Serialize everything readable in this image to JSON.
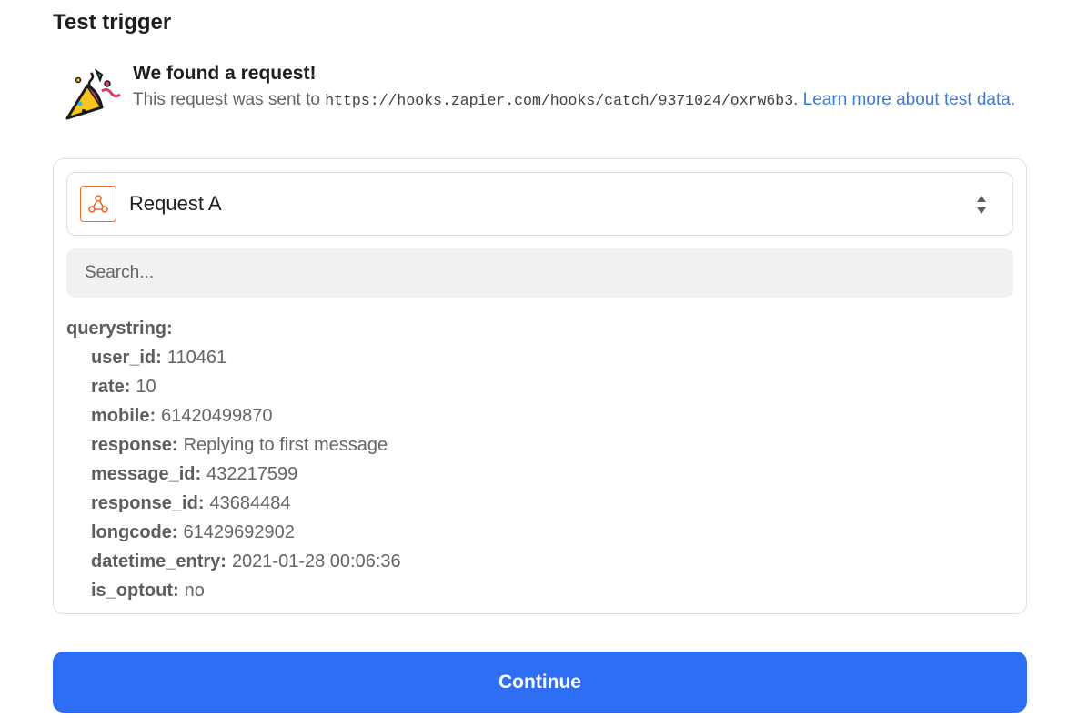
{
  "page": {
    "title": "Test trigger"
  },
  "found": {
    "heading": "We found a request!",
    "desc_prefix": "This request was sent to ",
    "url": "https://hooks.zapier.com/hooks/catch/9371024/oxrw6b3",
    "desc_suffix": ". ",
    "link_text": "Learn more about test data."
  },
  "selector": {
    "icon": "webhook-icon",
    "label": "Request A",
    "accent": "#f06a25"
  },
  "search": {
    "placeholder": "Search..."
  },
  "data": {
    "root_key": "querystring:",
    "rows": [
      {
        "key": "user_id:",
        "value": "110461"
      },
      {
        "key": "rate:",
        "value": "10"
      },
      {
        "key": "mobile:",
        "value": "61420499870"
      },
      {
        "key": "response:",
        "value": "Replying to first message"
      },
      {
        "key": "message_id:",
        "value": "432217599"
      },
      {
        "key": "response_id:",
        "value": "43684484"
      },
      {
        "key": "longcode:",
        "value": "61429692902"
      },
      {
        "key": "datetime_entry:",
        "value": "2021-01-28 00:06:36"
      },
      {
        "key": "is_optout:",
        "value": "no"
      }
    ]
  },
  "actions": {
    "continue_label": "Continue",
    "primary_color": "#2d6ef5"
  }
}
